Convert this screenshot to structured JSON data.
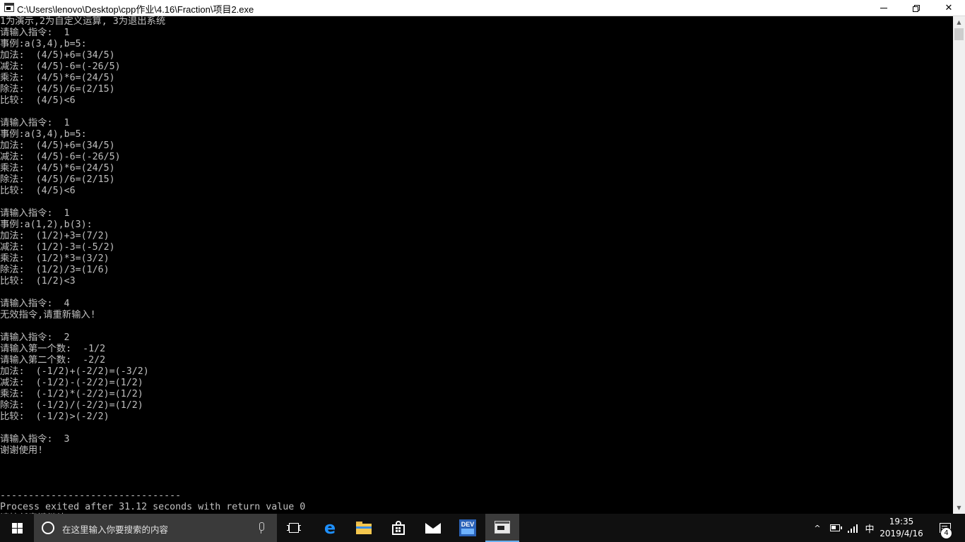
{
  "window": {
    "title": "C:\\Users\\lenovo\\Desktop\\cpp作业\\4.16\\Fraction\\项目2.exe",
    "icon": "console-app-icon",
    "controls": {
      "minimize_icon": "minimize-icon",
      "maximize_icon": "restore-icon",
      "close_icon": "close-icon",
      "close_glyph": "✕"
    }
  },
  "console": {
    "text_color": "#c0c0c0",
    "background": "#000000",
    "lines": [
      "1为演示,2为自定义运算, 3为退出系统",
      "请输入指令:  1",
      "事例:a(3,4),b=5:",
      "加法:  (4/5)+6=(34/5)",
      "减法:  (4/5)-6=(-26/5)",
      "乘法:  (4/5)*6=(24/5)",
      "除法:  (4/5)/6=(2/15)",
      "比较:  (4/5)<6",
      "",
      "请输入指令:  1",
      "事例:a(3,4),b=5:",
      "加法:  (4/5)+6=(34/5)",
      "减法:  (4/5)-6=(-26/5)",
      "乘法:  (4/5)*6=(24/5)",
      "除法:  (4/5)/6=(2/15)",
      "比较:  (4/5)<6",
      "",
      "请输入指令:  1",
      "事例:a(1,2),b(3):",
      "加法:  (1/2)+3=(7/2)",
      "减法:  (1/2)-3=(-5/2)",
      "乘法:  (1/2)*3=(3/2)",
      "除法:  (1/2)/3=(1/6)",
      "比较:  (1/2)<3",
      "",
      "请输入指令:  4",
      "无效指令,请重新输入!",
      "",
      "请输入指令:  2",
      "请输入第一个数:  -1/2",
      "请输入第二个数:  -2/2",
      "加法:  (-1/2)+(-2/2)=(-3/2)",
      "减法:  (-1/2)-(-2/2)=(1/2)",
      "乘法:  (-1/2)*(-2/2)=(1/2)",
      "除法:  (-1/2)/(-2/2)=(1/2)",
      "比较:  (-1/2)>(-2/2)",
      "",
      "请输入指令:  3",
      "谢谢使用!",
      "",
      "",
      "",
      "--------------------------------",
      "Process exited after 31.12 seconds with return value 0",
      "请按任意键继续. . ."
    ]
  },
  "scrollbar": {
    "up_glyph": "▲",
    "down_glyph": "▼"
  },
  "taskbar": {
    "search_placeholder": "在这里输入你要搜索的内容",
    "apps": [
      {
        "name": "task-view",
        "icon": "task-view-icon"
      },
      {
        "name": "edge",
        "icon": "edge-icon",
        "glyph": "e"
      },
      {
        "name": "file-explorer",
        "icon": "folder-icon"
      },
      {
        "name": "store",
        "icon": "store-icon"
      },
      {
        "name": "mail",
        "icon": "mail-icon"
      },
      {
        "name": "dev-cpp",
        "icon": "devcpp-icon",
        "glyph": "DEV"
      },
      {
        "name": "console-window",
        "icon": "console-icon",
        "active": true
      }
    ],
    "tray": {
      "chevron": "^",
      "ime": "中",
      "time": "19:35",
      "date": "2019/4/16",
      "notification_count": "4"
    }
  }
}
